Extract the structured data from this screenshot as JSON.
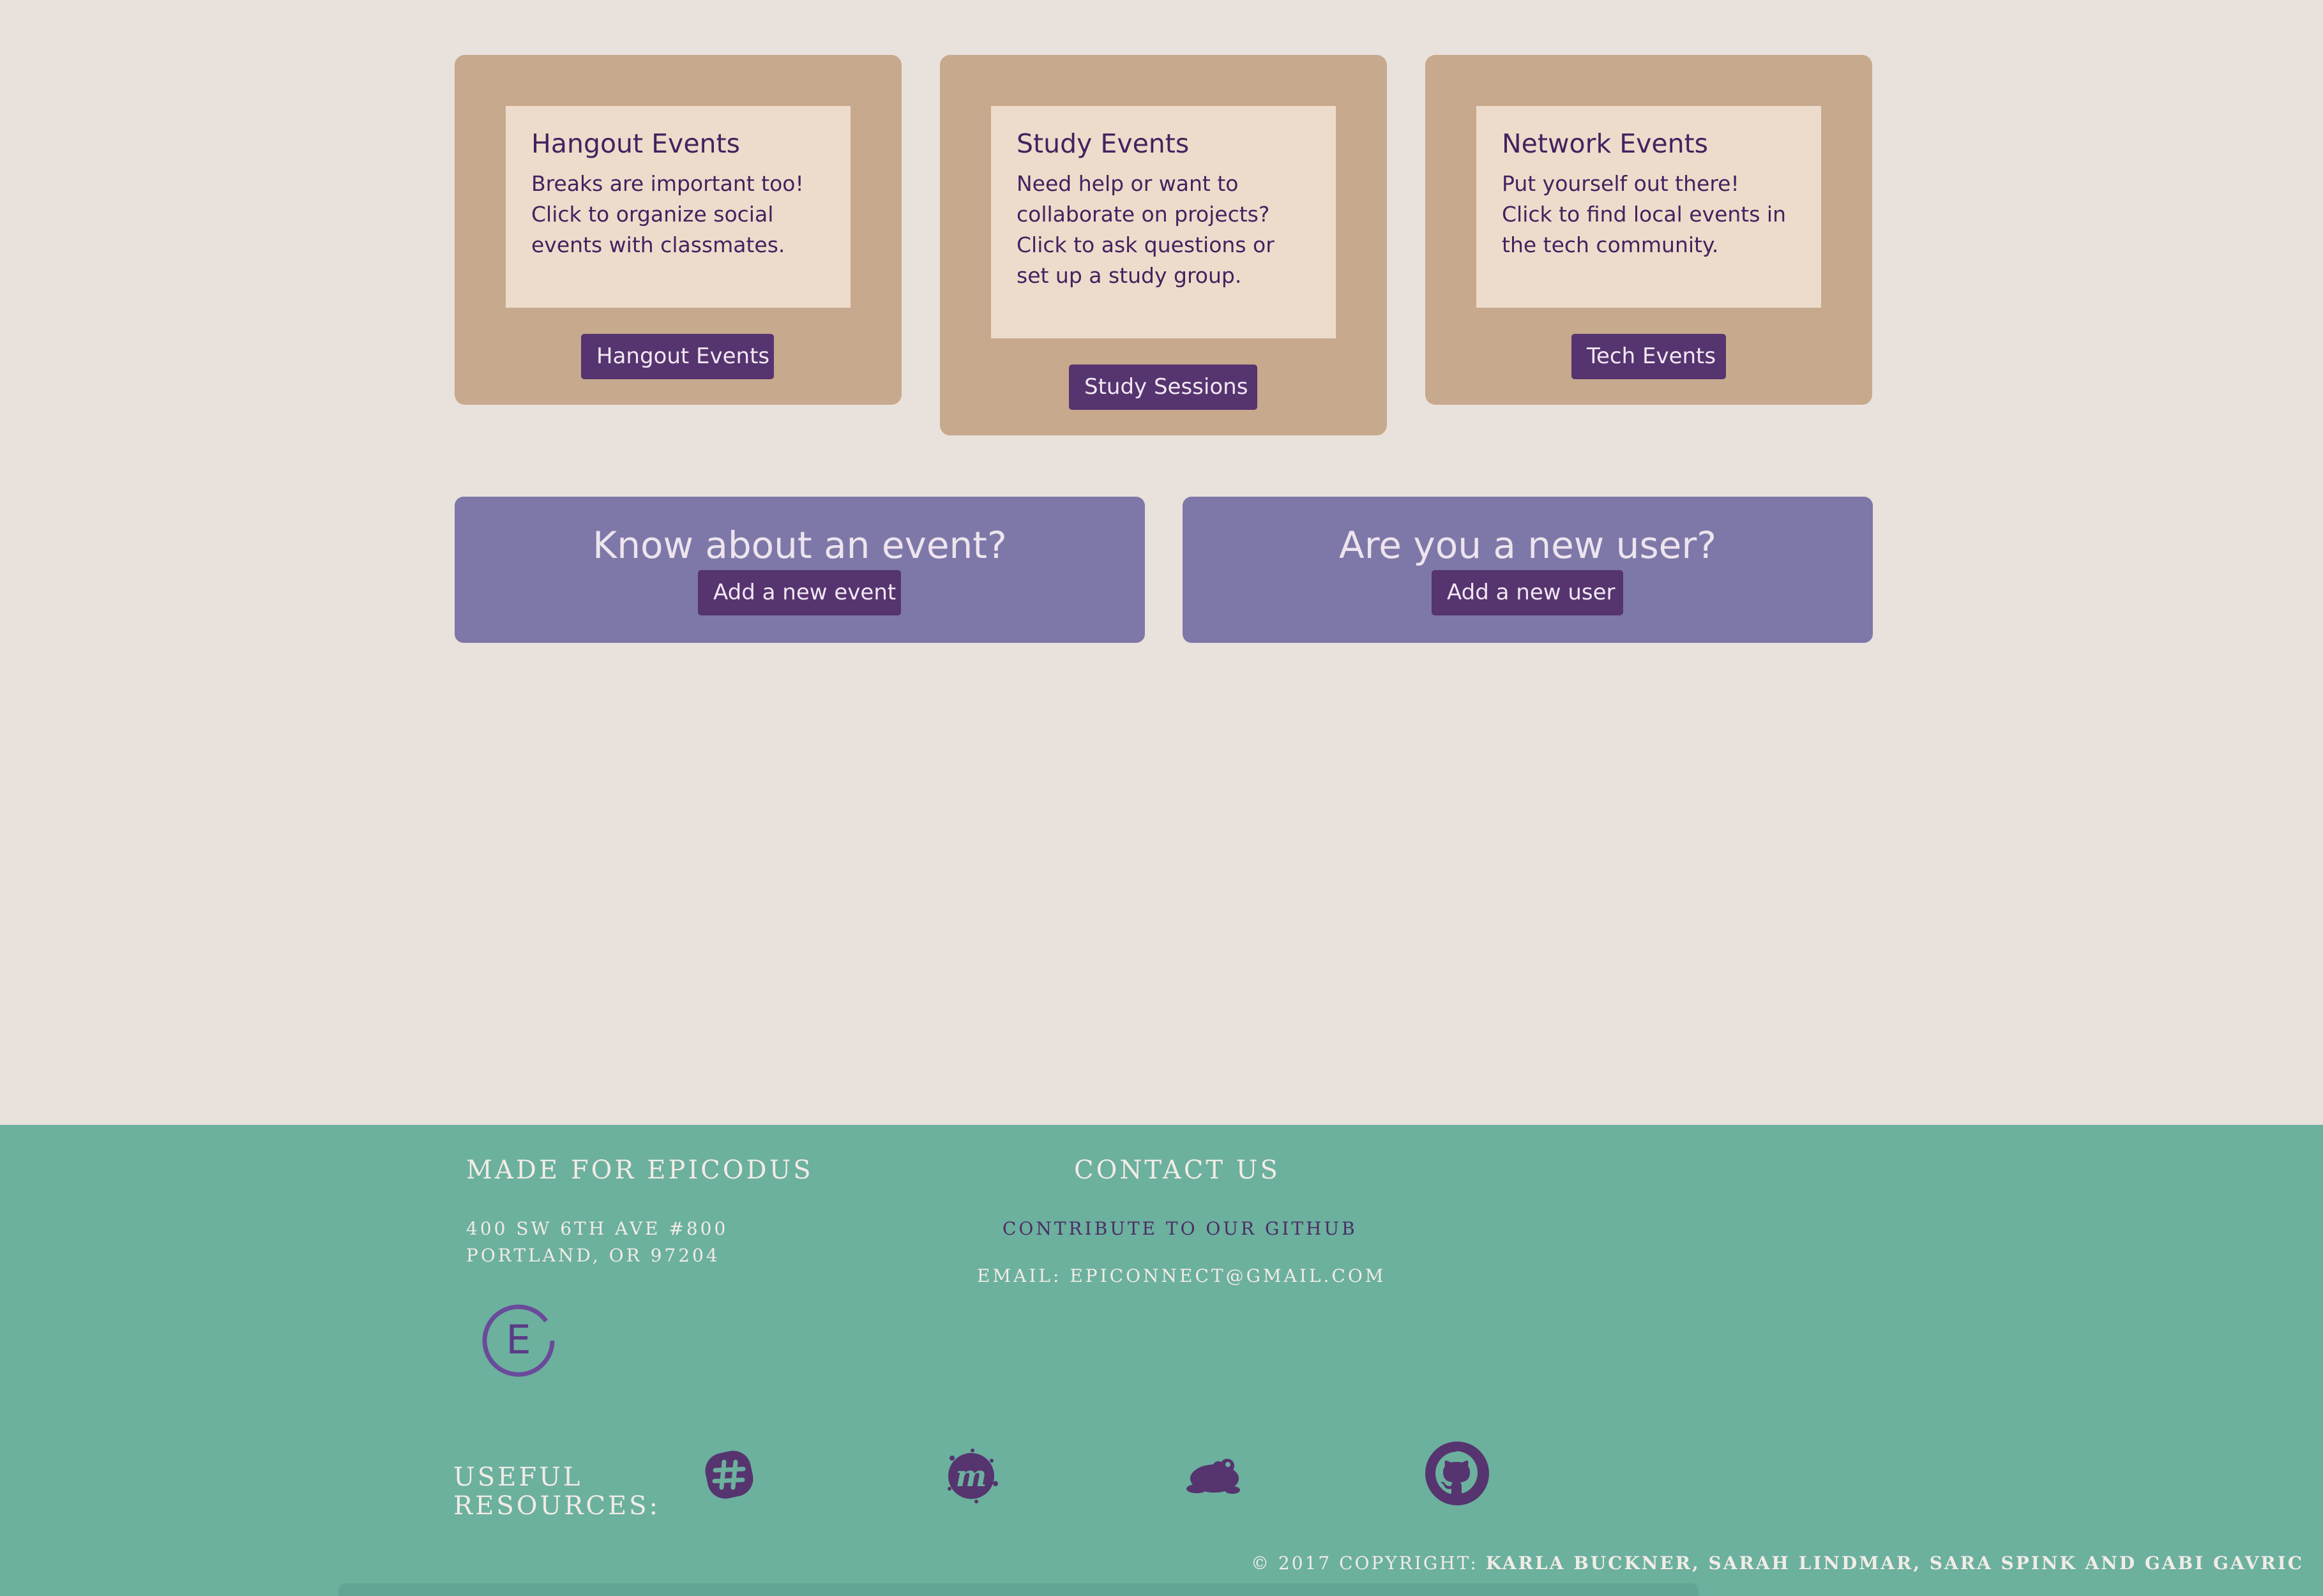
{
  "cards": [
    {
      "title": "Hangout Events",
      "description": "Breaks are important too! Click to organize social events with classmates.",
      "button": "Hangout Events"
    },
    {
      "title": "Study Events",
      "description": "Need help or want to collaborate on projects? Click to ask questions or set up a study group.",
      "button": "Study Sessions"
    },
    {
      "title": "Network Events",
      "description": "Put yourself out there! Click to find local events in the tech community.",
      "button": "Tech Events"
    }
  ],
  "panels": {
    "event": {
      "heading": "Know about an event?",
      "button": "Add a new event"
    },
    "user": {
      "heading": "Are you a new user?",
      "button": "Add a new user"
    }
  },
  "footer": {
    "made_for": "MADE FOR EPICODUS",
    "address_line1": "400 SW 6TH AVE #800",
    "address_line2": "PORTLAND, OR 97204",
    "logo_letter": "E",
    "contact_heading": "CONTACT US",
    "github_link": "CONTRIBUTE TO OUR GITHUB",
    "email": "EMAIL: EPICONNECT@GMAIL.COM",
    "resources_label_1": "USEFUL",
    "resources_label_2": "RESOURCES:",
    "resource_icons": [
      "slack-icon",
      "meetup-icon",
      "frog-icon",
      "github-icon"
    ],
    "copyright_prefix": "© 2017 COPYRIGHT:",
    "copyright_names": "KARLA BUCKNER, SARAH LINDMAR, SARA SPINK AND GABI GAVRIC"
  },
  "colors": {
    "page_bg": "#e9e1dc",
    "card_bg": "#c7a98d",
    "card_inner_bg": "#eddccb",
    "button_bg": "#56346f",
    "panel_bg": "#7d78a8",
    "footer_bg": "#6cb09e",
    "icon_color": "#56346f"
  }
}
